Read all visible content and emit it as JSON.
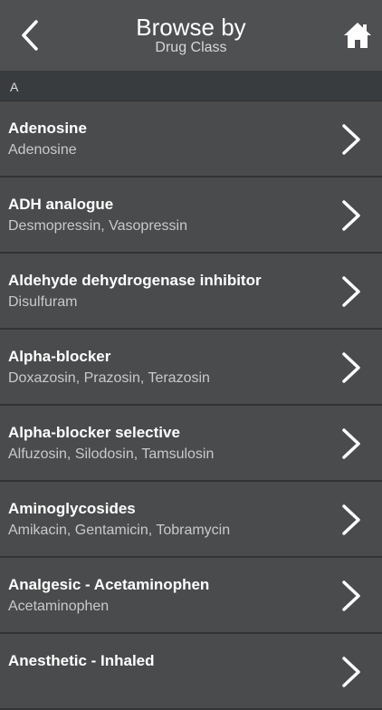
{
  "header": {
    "title": "Browse by",
    "subtitle": "Drug Class",
    "back_icon": "chevron-left-icon",
    "home_icon": "home-icon"
  },
  "section": {
    "label": "A"
  },
  "items": [
    {
      "title": "Adenosine",
      "subtitle": "Adenosine"
    },
    {
      "title": "ADH analogue",
      "subtitle": "Desmopressin, Vasopressin"
    },
    {
      "title": "Aldehyde dehydrogenase inhibitor",
      "subtitle": "Disulfuram"
    },
    {
      "title": "Alpha-blocker",
      "subtitle": "Doxazosin, Prazosin, Terazosin"
    },
    {
      "title": "Alpha-blocker selective",
      "subtitle": "Alfuzosin, Silodosin, Tamsulosin"
    },
    {
      "title": "Aminoglycosides",
      "subtitle": "Amikacin, Gentamicin, Tobramycin"
    },
    {
      "title": "Analgesic - Acetaminophen",
      "subtitle": "Acetaminophen"
    },
    {
      "title": "Anesthetic - Inhaled",
      "subtitle": ""
    }
  ],
  "colors": {
    "background": "#4a4b4c",
    "header": "#4f5051",
    "section": "#383c3f",
    "divider": "#323334",
    "subtitle_text": "#c9c9c9"
  }
}
